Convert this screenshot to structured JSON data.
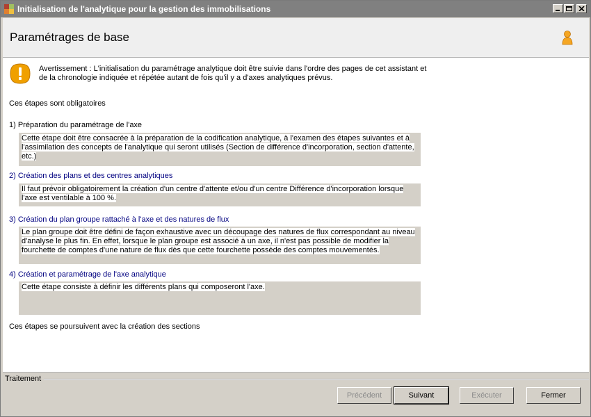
{
  "window": {
    "title": "Initialisation de l'analytique pour la gestion des immobilisations",
    "controls": [
      "minimize-icon",
      "maximize-icon",
      "close-icon"
    ]
  },
  "header": {
    "title": "Paramétrages de base",
    "icon": "user-icon"
  },
  "warning": {
    "icon": "warning-icon",
    "text": "Avertissement : L'initialisation du paramétrage analytique doit être suivie dans l'ordre des pages de cet assistant et de la chronologie indiquée et répétée autant de fois qu'il y a d'axes analytiques prévus."
  },
  "intro": "Ces étapes sont obligatoires",
  "steps": [
    {
      "title": "1) Préparation du paramétrage de l'axe",
      "description": "Cette étape doit être consacrée à la préparation de la codification analytique, à l'examen des étapes suivantes et à l'assimilation des concepts de l'analytique qui seront utilisés (Section de différence d'incorporation, section d'attente, etc.)"
    },
    {
      "title": "2) Création des plans et des centres analytiques",
      "description": "Il faut prévoir obligatoirement la création d'un centre d'attente et/ou d'un centre Différence d'incorporation lorsque l'axe est ventilable à 100 %."
    },
    {
      "title": "3) Création du plan groupe rattaché à l'axe et des natures de flux",
      "description": "Le plan groupe doit être défini de façon exhaustive avec un découpage des natures de flux correspondant au niveau d'analyse le plus fin. En effet, lorsque le plan groupe est associé à un axe, il n'est pas possible de modifier la fourchette de comptes d'une nature de flux dès que cette fourchette possède des comptes mouvementés."
    },
    {
      "title": "4) Création et paramétrage de l'axe analytique",
      "description": "Cette étape consiste à définir les différents plans qui composeront l'axe."
    }
  ],
  "outro": "Ces étapes se poursuivent avec la création des sections",
  "footer": {
    "label": "Traitement",
    "buttons": {
      "previous": "Précédent",
      "next": "Suivant",
      "execute": "Exécuter",
      "close": "Fermer"
    }
  },
  "colors": {
    "titlebar": "#808080",
    "step_link": "#000080",
    "description_bg": "#d4d0c8",
    "warning": "#f0a000",
    "user": "#f5a623"
  }
}
